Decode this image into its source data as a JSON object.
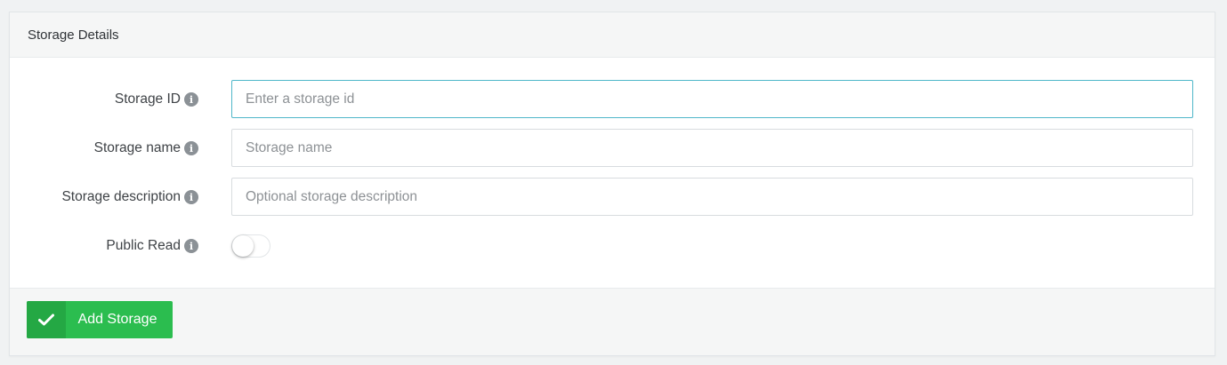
{
  "panel": {
    "title": "Storage Details"
  },
  "form": {
    "storage_id": {
      "label": "Storage ID",
      "value": "",
      "placeholder": "Enter a storage id",
      "info_icon": "info-icon"
    },
    "storage_name": {
      "label": "Storage name",
      "value": "",
      "placeholder": "Storage name",
      "info_icon": "info-icon"
    },
    "storage_description": {
      "label": "Storage description",
      "value": "",
      "placeholder": "Optional storage description",
      "info_icon": "info-icon"
    },
    "public_read": {
      "label": "Public Read",
      "enabled": false,
      "info_icon": "info-icon"
    }
  },
  "footer": {
    "add_button_label": "Add Storage",
    "add_button_icon": "checkmark-icon"
  },
  "colors": {
    "accent_green": "#2bbd4f",
    "accent_green_dark": "#24a844",
    "focus_border": "#4fb7c9",
    "info_icon": "#8b9196"
  }
}
